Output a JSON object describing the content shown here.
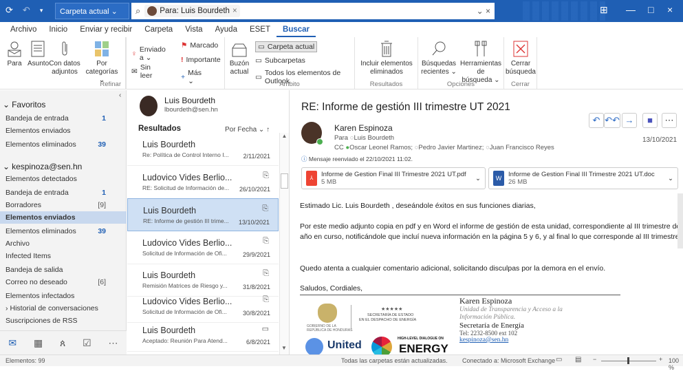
{
  "titlebar": {
    "folder_scope": "Carpeta actual ⌄",
    "search_chip": "Para: Luis Bourdeth",
    "search_chip_close": "×",
    "search_tail": "⌄  ×",
    "win_min": "—",
    "win_max": "□",
    "win_close": "×",
    "colors": {
      "accent": "#1f5fb4"
    }
  },
  "menu": {
    "items": [
      "Archivo",
      "Inicio",
      "Enviar y recibir",
      "Carpeta",
      "Vista",
      "Ayuda",
      "ESET",
      "Buscar"
    ]
  },
  "ribbon": {
    "refinar": {
      "label": "Refinar",
      "para": "Para",
      "asunto": "Asunto",
      "con_datos_1": "Con datos",
      "con_datos_2": "adjuntos",
      "por_1": "Por",
      "por_2": "categorías ⌄",
      "enviado_a": "Enviado a ⌄",
      "sin_leer": "Sin leer",
      "marcado": "Marcado",
      "importante": "Importante",
      "mas": "Más ⌄"
    },
    "ambito": {
      "label": "Ámbito",
      "buzon_1": "Buzón",
      "buzon_2": "actual",
      "carpeta_actual": "Carpeta actual",
      "subcarpetas": "Subcarpetas",
      "todos": "Todos los elementos de Outlook"
    },
    "resultados": {
      "label": "Resultados",
      "incluir_1": "Incluir elementos",
      "incluir_2": "eliminados"
    },
    "opciones": {
      "label": "Opciones",
      "busq_1": "Búsquedas",
      "busq_2": "recientes ⌄",
      "herr_1": "Herramientas de",
      "herr_2": "búsqueda ⌄"
    },
    "cerrar": {
      "label": "Cerrar",
      "cerrar_1": "Cerrar",
      "cerrar_2": "búsqueda"
    }
  },
  "nav": {
    "favoritos": "Favoritos",
    "fav_items": [
      {
        "label": "Bandeja de entrada",
        "count": "1"
      },
      {
        "label": "Elementos enviados",
        "count": ""
      },
      {
        "label": "Elementos eliminados",
        "count": "39"
      }
    ],
    "account": "kespinoza@sen.hn",
    "acc_items": [
      {
        "label": "Elementos detectados",
        "count": ""
      },
      {
        "label": "Bandeja de entrada",
        "count": "1"
      },
      {
        "label": "Borradores",
        "count": "[9]"
      },
      {
        "label": "Elementos enviados",
        "count": ""
      },
      {
        "label": "Elementos eliminados",
        "count": "39"
      },
      {
        "label": "Archivo",
        "count": ""
      },
      {
        "label": "Infected Items",
        "count": ""
      },
      {
        "label": "Bandeja de salida",
        "count": ""
      },
      {
        "label": "Correo no deseado",
        "count": "[6]"
      },
      {
        "label": "Elementos infectados",
        "count": ""
      },
      {
        "label": "Historial de conversaciones",
        "count": ""
      },
      {
        "label": "Suscripciones de RSS",
        "count": ""
      }
    ]
  },
  "list": {
    "contact_name": "Luis Bourdeth",
    "contact_email": "lbourdeth@sen.hn",
    "results": "Resultados",
    "sort": "Por Fecha ⌄  ↑",
    "items": [
      {
        "name": "Luis Bourdeth",
        "subject": "Re: Política de Control Interno I...",
        "date": "2/11/2021",
        "att": ""
      },
      {
        "name": "Ludovico Vides Berlio...",
        "subject": "RE: Solicitud de Información de...",
        "date": "26/10/2021",
        "att": "⎘"
      },
      {
        "name": "Luis Bourdeth",
        "subject": "RE: Informe de gestión III trime...",
        "date": "13/10/2021",
        "att": "⎘"
      },
      {
        "name": "Ludovico Vides Berlio...",
        "subject": "Solicitud de Información de Ofi...",
        "date": "29/9/2021",
        "att": "⎘"
      },
      {
        "name": "Luis Bourdeth",
        "subject": "Remisión Matrices de Riesgo y...",
        "date": "31/8/2021",
        "att": "⎘"
      },
      {
        "name": "Ludovico Vides Berlio...",
        "subject": "Solicitud de Información de Ofi...",
        "date": "30/8/2021",
        "att": "⎘"
      },
      {
        "name": "Luis Bourdeth",
        "subject": "Aceptado: Reunión Para Atend...",
        "date": "6/8/2021",
        "att": "▭"
      }
    ]
  },
  "reading": {
    "subject": "RE: Informe de gestión III trimestre UT 2021",
    "from": "Karen Espinoza",
    "to_label": "Para",
    "to": "Luis Bourdeth",
    "cc_label": "CC",
    "cc1": "Oscar Leonel Ramos;",
    "cc2": "Pedro Javier Martinez;",
    "cc3": "Juan Francisco Reyes",
    "date": "13/10/2021",
    "forwarded": "Mensaje reenviado el 22/10/2021 11:02.",
    "att1_name": "Informe de Gestion Final III Trimestre 2021 UT.pdf",
    "att1_size": "5 MB",
    "att2_name": "Informe de Gestion Final III Trimestre 2021 UT.doc",
    "att2_size": "26 MB",
    "p1": "Estimado Lic. Luis Bourdeth , deseándole éxitos en sus funciones diarias,",
    "p2": "Por este medio adjunto copia en pdf y en Word el informe de gestión de esta unidad, correspondiente al III trimestre del año en curso, notificándole que incluí nueva información en la página 5 y 6, y al final lo que corresponde al III trimestre.",
    "p3": "Quedo atenta a cualquier comentario adicional, solicitando disculpas por la demora en el envío.",
    "p4": "Saludos, Cordiales,",
    "sig_name": "Karen Espinoza",
    "sig_role": "Unidad de Transparencia y Acceso a la Información Pública.",
    "sig_org": "Secretaría de Energía",
    "sig_tel": "Tel: 2232-8500 ext 102",
    "sig_email": "kespinoza@sen.hn",
    "logo_sec1": "SECRETARÍA DE ESTADO",
    "logo_sec2": "EN EL DESPACHO DE ENERGÍA",
    "logo_gob1": "GOBIERNO DE LA",
    "logo_gob2": "REPÚBLICA DE HONDURAS",
    "logo_un": "United",
    "logo_hl": "HIGH-LEVEL DIALOGUE ON",
    "logo_energy": "ENERGY"
  },
  "status": {
    "items": "Elementos: 99",
    "sync": "Todas las carpetas están actualizadas.",
    "conn": "Conectado a: Microsoft Exchange",
    "zoom": "100 %"
  }
}
